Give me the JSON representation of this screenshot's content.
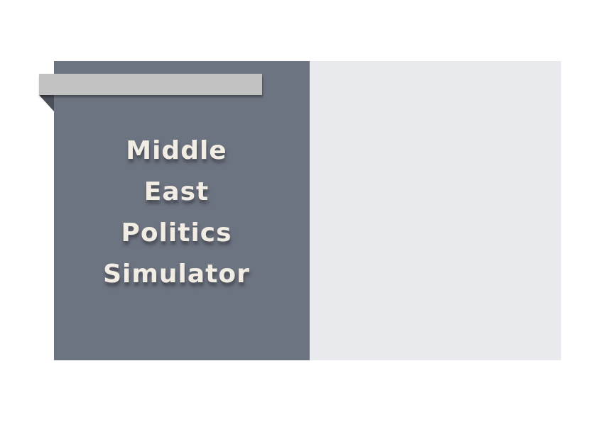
{
  "slide": {
    "title_lines": [
      "Middle",
      "East",
      "Politics",
      "Simulator"
    ]
  },
  "colors": {
    "left_panel": "#6d7481",
    "right_panel": "#e9eaed",
    "ribbon": "#c2c2c2",
    "ribbon_fold": "#4b4f58",
    "title_text": "#f1ece4"
  }
}
